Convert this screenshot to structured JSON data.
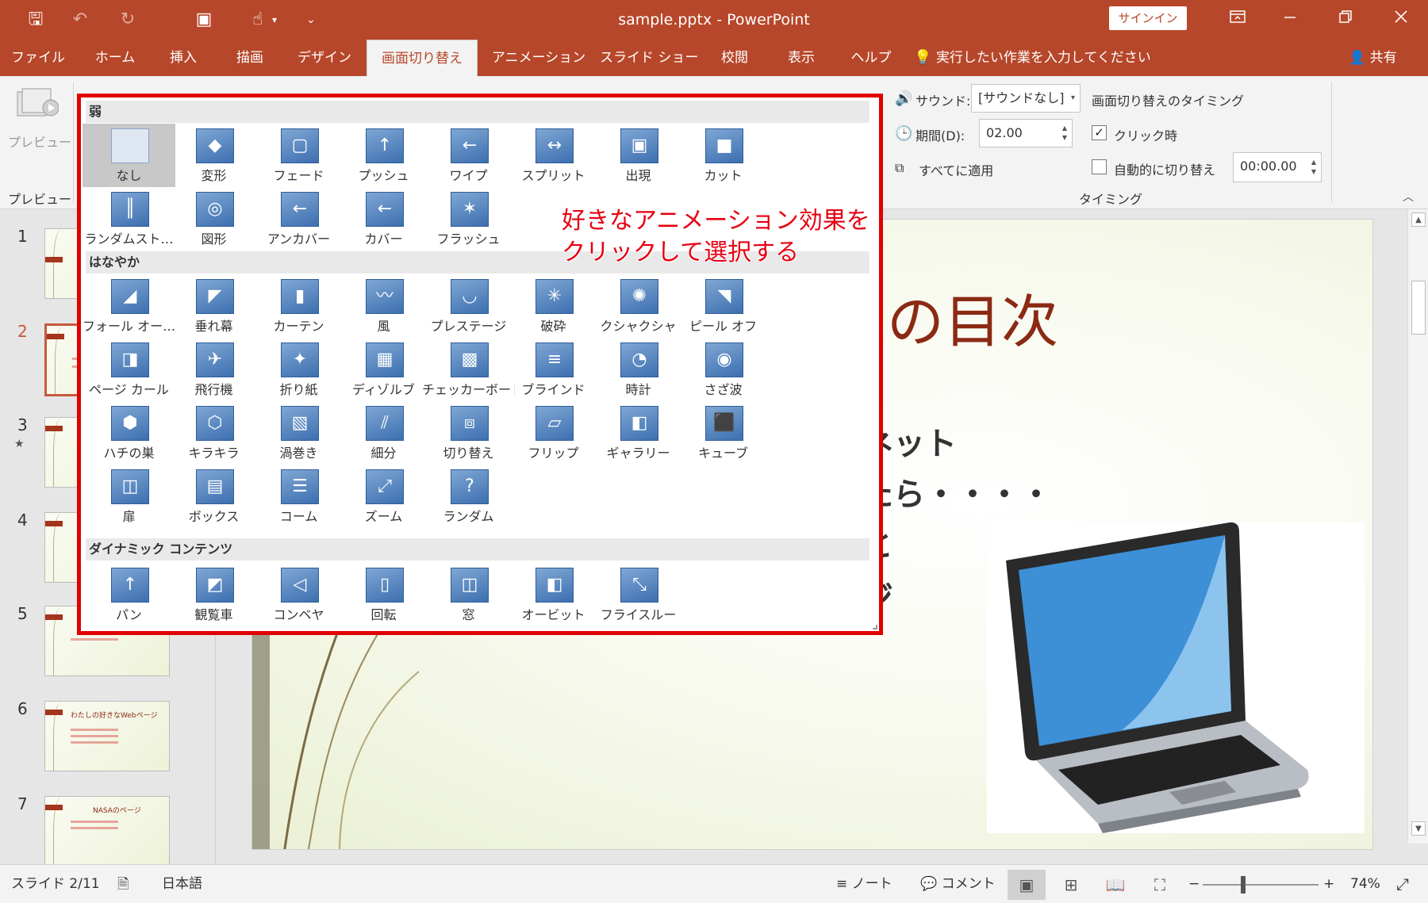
{
  "window": {
    "title": "sample.pptx  -  PowerPoint",
    "signin": "サインイン"
  },
  "qat": {
    "save": "🖫",
    "undo": "↶",
    "redo": "↻",
    "present": "▣",
    "touch": "☝",
    "more": "▾",
    "customize": "⌄"
  },
  "tabs": [
    {
      "label": "ファイル"
    },
    {
      "label": "ホーム"
    },
    {
      "label": "挿入"
    },
    {
      "label": "描画"
    },
    {
      "label": "デザイン"
    },
    {
      "label": "画面切り替え"
    },
    {
      "label": "アニメーション"
    },
    {
      "label": "スライド ショー"
    },
    {
      "label": "校閲"
    },
    {
      "label": "表示"
    },
    {
      "label": "ヘルプ"
    }
  ],
  "tellme": "実行したい作業を入力してください",
  "share": "共有",
  "ribbon": {
    "preview_label": "プレビュー",
    "preview_group": "プレビュー",
    "sound_label": "サウンド:",
    "sound_value": "[サウンドなし]",
    "duration_label": "期間(D):",
    "duration_value": "02.00",
    "apply_all": "すべてに適用",
    "timing_heading": "画面切り替えのタイミング",
    "on_click": "クリック時",
    "on_click_checked": true,
    "auto_after": "自動的に切り替え",
    "auto_after_checked": false,
    "auto_time": "00:00.00",
    "timing_group": "タイミング"
  },
  "gallery": {
    "sections": [
      {
        "title": "弱"
      },
      {
        "title": "はなやか"
      },
      {
        "title": "ダイナミック コンテンツ"
      }
    ],
    "subtle": [
      {
        "label": "なし",
        "icon": "none"
      },
      {
        "label": "変形",
        "icon": "morph"
      },
      {
        "label": "フェード",
        "icon": "fade"
      },
      {
        "label": "プッシュ",
        "icon": "push"
      },
      {
        "label": "ワイプ",
        "icon": "wipe"
      },
      {
        "label": "スプリット",
        "icon": "split"
      },
      {
        "label": "出現",
        "icon": "reveal"
      },
      {
        "label": "カット",
        "icon": "cut"
      },
      {
        "label": "ランダムスト…",
        "icon": "random-bars"
      },
      {
        "label": "図形",
        "icon": "shape"
      },
      {
        "label": "アンカバー",
        "icon": "uncover"
      },
      {
        "label": "カバー",
        "icon": "cover"
      },
      {
        "label": "フラッシュ",
        "icon": "flash"
      }
    ],
    "exciting": [
      {
        "label": "フォール オー…",
        "icon": "fall-over"
      },
      {
        "label": "垂れ幕",
        "icon": "drape"
      },
      {
        "label": "カーテン",
        "icon": "curtains"
      },
      {
        "label": "風",
        "icon": "wind"
      },
      {
        "label": "プレステージ",
        "icon": "prestige"
      },
      {
        "label": "破砕",
        "icon": "fracture"
      },
      {
        "label": "クシャクシャ",
        "icon": "crush"
      },
      {
        "label": "ピール オフ",
        "icon": "peel-off"
      },
      {
        "label": "ページ カール",
        "icon": "page-curl"
      },
      {
        "label": "飛行機",
        "icon": "airplane"
      },
      {
        "label": "折り紙",
        "icon": "origami"
      },
      {
        "label": "ディゾルブ",
        "icon": "dissolve"
      },
      {
        "label": "チェッカーボード",
        "icon": "checkerboard"
      },
      {
        "label": "ブラインド",
        "icon": "blinds"
      },
      {
        "label": "時計",
        "icon": "clock"
      },
      {
        "label": "さざ波",
        "icon": "ripple"
      },
      {
        "label": "ハチの巣",
        "icon": "honeycomb"
      },
      {
        "label": "キラキラ",
        "icon": "glitter"
      },
      {
        "label": "渦巻き",
        "icon": "vortex"
      },
      {
        "label": "細分",
        "icon": "shred"
      },
      {
        "label": "切り替え",
        "icon": "switch"
      },
      {
        "label": "フリップ",
        "icon": "flip"
      },
      {
        "label": "ギャラリー",
        "icon": "gallery"
      },
      {
        "label": "キューブ",
        "icon": "cube"
      },
      {
        "label": "扉",
        "icon": "doors"
      },
      {
        "label": "ボックス",
        "icon": "box"
      },
      {
        "label": "コーム",
        "icon": "comb"
      },
      {
        "label": "ズーム",
        "icon": "zoom"
      },
      {
        "label": "ランダム",
        "icon": "random"
      }
    ],
    "dynamic": [
      {
        "label": "パン",
        "icon": "pan"
      },
      {
        "label": "観覧車",
        "icon": "ferris-wheel"
      },
      {
        "label": "コンベヤ",
        "icon": "conveyor"
      },
      {
        "label": "回転",
        "icon": "rotate"
      },
      {
        "label": "窓",
        "icon": "window"
      },
      {
        "label": "オービット",
        "icon": "orbit"
      },
      {
        "label": "フライスルー",
        "icon": "fly-through"
      }
    ]
  },
  "callout": {
    "line1": "好きなアニメーション効果を",
    "line2": "クリックして選択する"
  },
  "thumbnails": [
    {
      "num": "1"
    },
    {
      "num": "2"
    },
    {
      "num": "3"
    },
    {
      "num": "4"
    },
    {
      "num": "5"
    },
    {
      "num": "6",
      "title": "わたしの好きなWebページ"
    },
    {
      "num": "7",
      "title": "NASAのページ"
    }
  ],
  "slide": {
    "title_fragment": "の目次",
    "line1": "ネット",
    "line2": "たら・・・・",
    "line3": "と",
    "line4": "ジ"
  },
  "status": {
    "slide": "スライド 2/11",
    "language": "日本語",
    "notes": "ノート",
    "comments": "コメント",
    "zoom": "74%",
    "zoom_minus": "−",
    "zoom_plus": "+"
  }
}
